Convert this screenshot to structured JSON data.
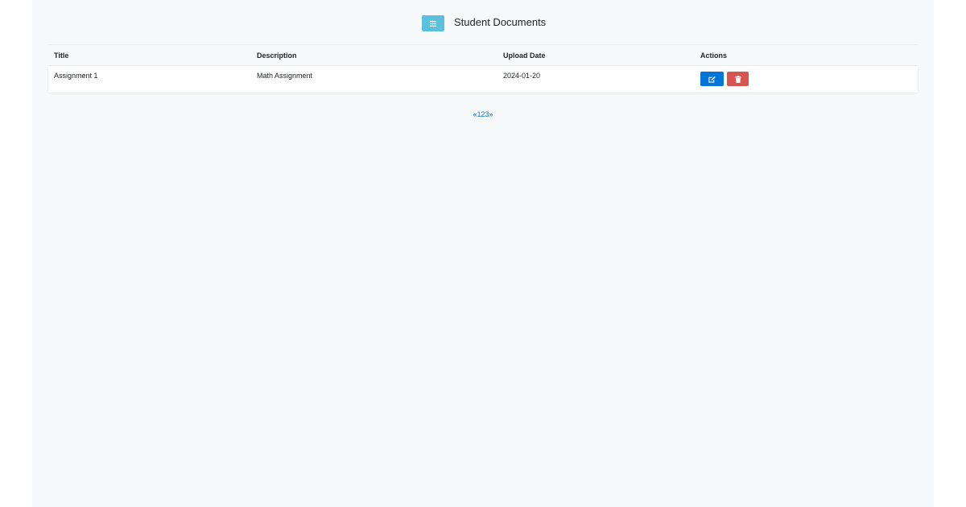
{
  "header": {
    "title": "Student Documents",
    "menu_icon": "hamburger-icon"
  },
  "table": {
    "columns": [
      "Title",
      "Description",
      "Upload Date",
      "Actions"
    ],
    "rows": [
      {
        "title": "Assignment 1",
        "description": "Math Assignment",
        "upload_date": "2024-01-20",
        "edit_icon": "edit-icon",
        "delete_icon": "trash-icon"
      }
    ]
  },
  "pagination": {
    "prev": "«",
    "pages": [
      "1",
      "2",
      "3"
    ],
    "next": "»"
  },
  "colors": {
    "menu_button": "#5bc0de",
    "edit_button": "#0275d8",
    "delete_button": "#d9534f",
    "link": "#0275d8",
    "page_background": "#f7f8fa"
  }
}
